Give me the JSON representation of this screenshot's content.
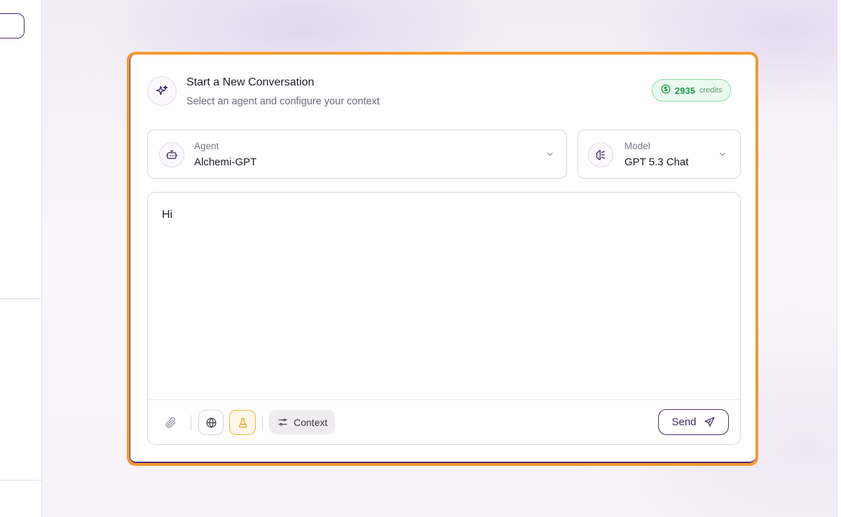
{
  "header": {
    "title": "Start a New Conversation",
    "subtitle": "Select an agent and configure your context",
    "icon": "sparkles-icon"
  },
  "credits": {
    "amount": "2935",
    "label": "credits",
    "icon": "dollar-coin-icon",
    "color": "#1f9b4e"
  },
  "agent_select": {
    "label": "Agent",
    "value": "Alchemi-GPT",
    "icon": "robot-icon"
  },
  "model_select": {
    "label": "Model",
    "value": "GPT 5.3 Chat",
    "icon": "brain-icon"
  },
  "editor": {
    "value": "Hi"
  },
  "toolbar": {
    "attach_icon": "paperclip-icon",
    "web_icon": "globe-icon",
    "lab_icon": "flask-icon",
    "context_label": "Context",
    "context_icon": "sliders-icon",
    "send_label": "Send",
    "send_icon": "paper-plane-icon"
  },
  "colors": {
    "highlight": "#f5982d",
    "brand": "#4b2a75",
    "credits_bg": "#ebf9ef"
  }
}
